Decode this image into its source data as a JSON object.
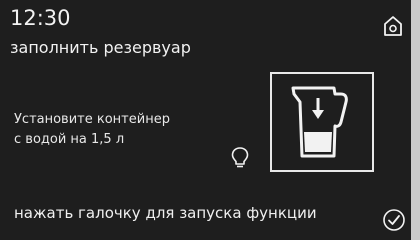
{
  "header": {
    "time": "12:30",
    "title": "заполнить резервуар"
  },
  "instruction": {
    "line1": "Установите контейнер",
    "line2": "с водой на 1,5 л"
  },
  "footer": {
    "text": "нажать галочку для запуска функции"
  },
  "icons": {
    "home": "home-icon",
    "hint": "lightbulb-icon",
    "jug": "water-jug-insert-icon",
    "confirm": "checkmark-circle-icon"
  },
  "colors": {
    "background": "#1e1e1e",
    "foreground": "#f2f2f2",
    "side_strip": "#c9c9c9"
  }
}
